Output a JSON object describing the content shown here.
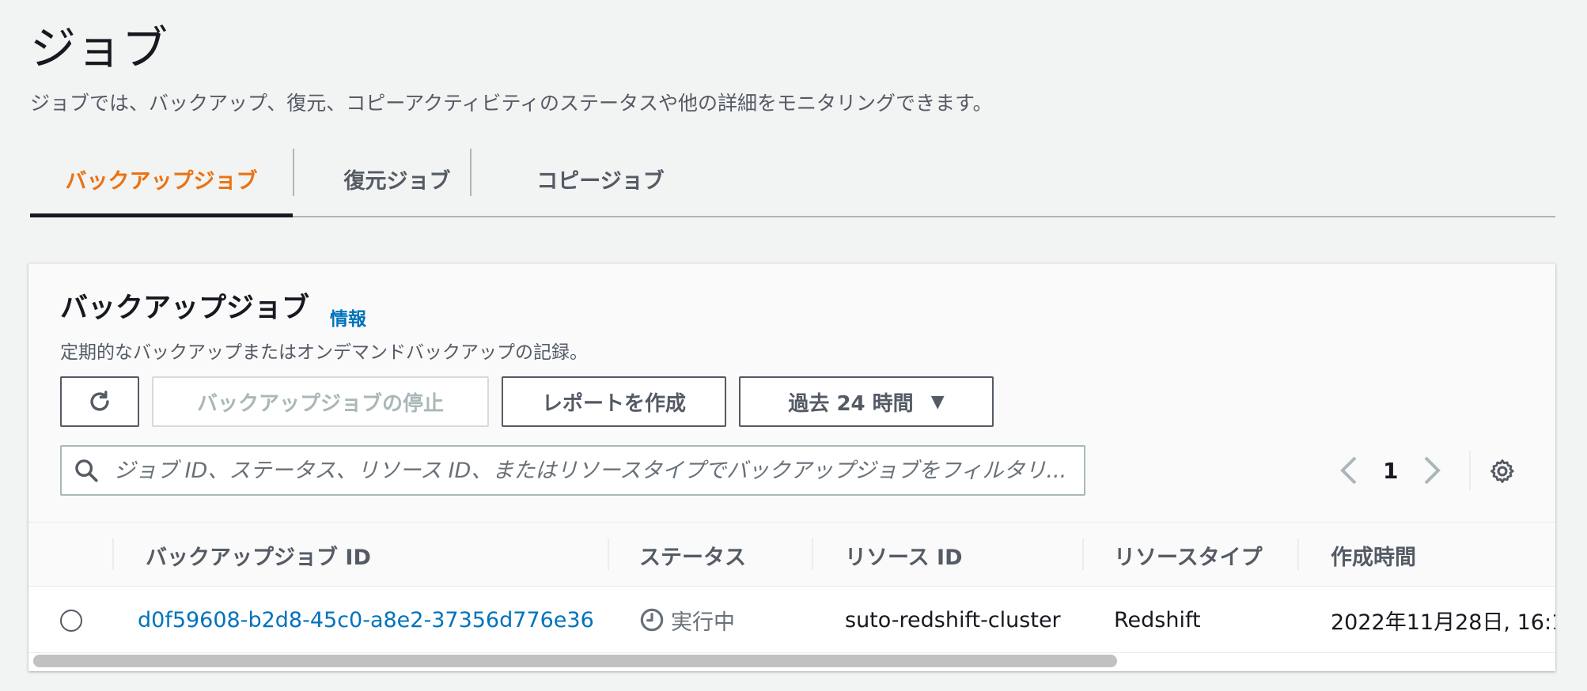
{
  "page": {
    "title": "ジョブ",
    "description": "ジョブでは、バックアップ、復元、コピーアクティビティのステータスや他の詳細をモニタリングできます。"
  },
  "tabs": [
    {
      "label": "バックアップジョブ",
      "active": true
    },
    {
      "label": "復元ジョブ",
      "active": false
    },
    {
      "label": "コピージョブ",
      "active": false
    }
  ],
  "panel": {
    "title": "バックアップジョブ",
    "info_link": "情報",
    "description": "定期的なバックアップまたはオンデマンドバックアップの記録。",
    "stop_button": "バックアップジョブの停止",
    "report_button": "レポートを作成",
    "time_range": "過去 24 時間"
  },
  "search": {
    "placeholder": "ジョブ ID、ステータス、リソース ID、またはリソースタイプでバックアップジョブをフィルタリ..."
  },
  "pagination": {
    "current_page": "1"
  },
  "table": {
    "columns": [
      "バックアップジョブ ID",
      "ステータス",
      "リソース ID",
      "リソースタイプ",
      "作成時間"
    ],
    "rows": [
      {
        "job_id": "d0f59608-b2d8-45c0-a8e2-37356d776e36",
        "status": "実行中",
        "resource_id": "suto-redshift-cluster",
        "resource_type": "Redshift",
        "created": "2022年11月28日, 16:1"
      }
    ]
  },
  "colors": {
    "accent_orange": "#ec7211",
    "link_blue": "#0073bb",
    "text_dark": "#16191f",
    "text_muted": "#545b64",
    "background": "#f2f3f3"
  }
}
